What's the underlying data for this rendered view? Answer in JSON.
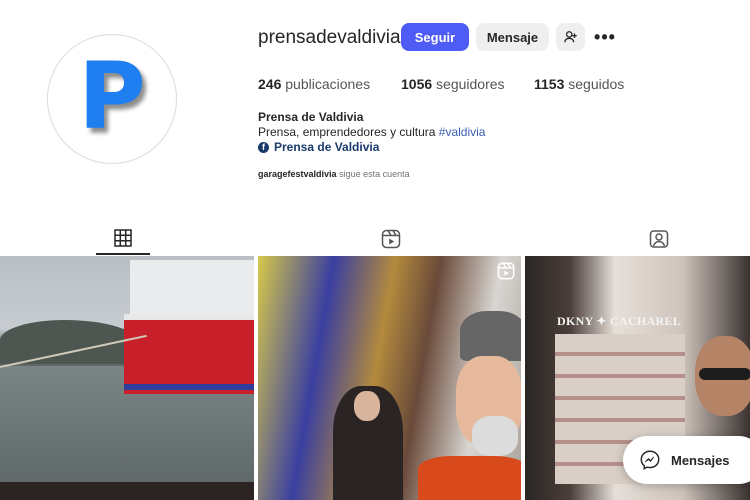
{
  "profile": {
    "avatar_letter": "P",
    "username": "prensadevaldivia",
    "follow_label": "Seguir",
    "message_label": "Mensaje",
    "more_label": "•••"
  },
  "stats": {
    "posts_count": "246",
    "posts_label": "publicaciones",
    "followers_count": "1056",
    "followers_label": "seguidores",
    "following_count": "1153",
    "following_label": "seguidos"
  },
  "bio": {
    "name": "Prensa de Valdivia",
    "text": "Prensa, emprendedores y cultura ",
    "hashtag": "#valdivia",
    "link_text": "Prensa de Valdivia"
  },
  "followed_by": {
    "account": "garagefestvaldivia",
    "text": "sigue esta cuenta"
  },
  "tabs": [
    {
      "name": "posts",
      "icon": "grid-icon",
      "active": true
    },
    {
      "name": "reels",
      "icon": "reels-icon",
      "active": false
    },
    {
      "name": "tagged",
      "icon": "tagged-icon",
      "active": false
    }
  ],
  "grid": {
    "shop_sign": "DKNY ✦ CACHAREL"
  },
  "messages_bar": {
    "label": "Mensajes"
  },
  "colors": {
    "accent": "#4f5bf5",
    "avatar_blue": "#1f7ef0"
  }
}
